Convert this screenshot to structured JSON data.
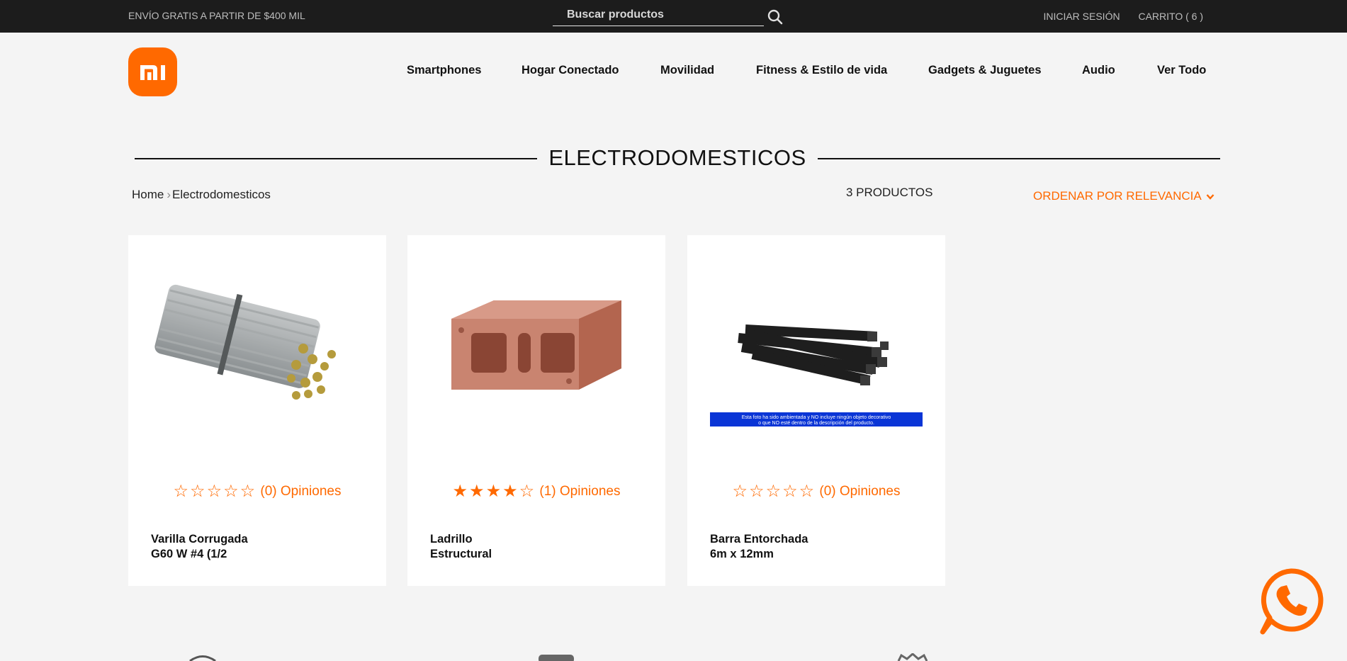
{
  "topbar": {
    "promo": "ENVÍO GRATIS A PARTIR DE $400 MIL",
    "search_placeholder": "Buscar productos",
    "login": "INICIAR SESIÓN",
    "cart": "CARRITO ( 6 )"
  },
  "brand": {
    "logo_text": "mi",
    "color": "#ff6900"
  },
  "nav": [
    "Smartphones",
    "Hogar Conectado",
    "Movilidad",
    "Fitness & Estilo de vida",
    "Gadgets & Juguetes",
    "Audio",
    "Ver Todo"
  ],
  "category": {
    "title": "ELECTRODOMESTICOS",
    "breadcrumb_home": "Home",
    "breadcrumb_current": "Electrodomesticos",
    "count": "3 PRODUCTOS",
    "sort": "ORDENAR POR RELEVANCIA"
  },
  "products": [
    {
      "name_line1": "Varilla Corrugada",
      "name_line2": "G60 W #4 (1/2",
      "stars": 0,
      "reviews": "(0) Opiniones",
      "image": "rebar-bundle"
    },
    {
      "name_line1": "Ladrillo",
      "name_line2": "Estructural",
      "stars": 4,
      "reviews": "(1) Opiniones",
      "image": "red-brick"
    },
    {
      "name_line1": "Barra Entorchada",
      "name_line2": "6m x 12mm",
      "stars": 0,
      "reviews": "(0) Opiniones",
      "image": "twisted-bars",
      "image_note": "Esta foto ha sido ambientada y NO incluye ningún objeto decorativo o que NO esté dentro de la descripción del producto."
    }
  ],
  "colors": {
    "accent": "#ff6900",
    "topbar": "#1c1c1c",
    "page_bg": "#f4f4f4"
  },
  "whatsapp_icon": "whatsapp-phone-icon"
}
